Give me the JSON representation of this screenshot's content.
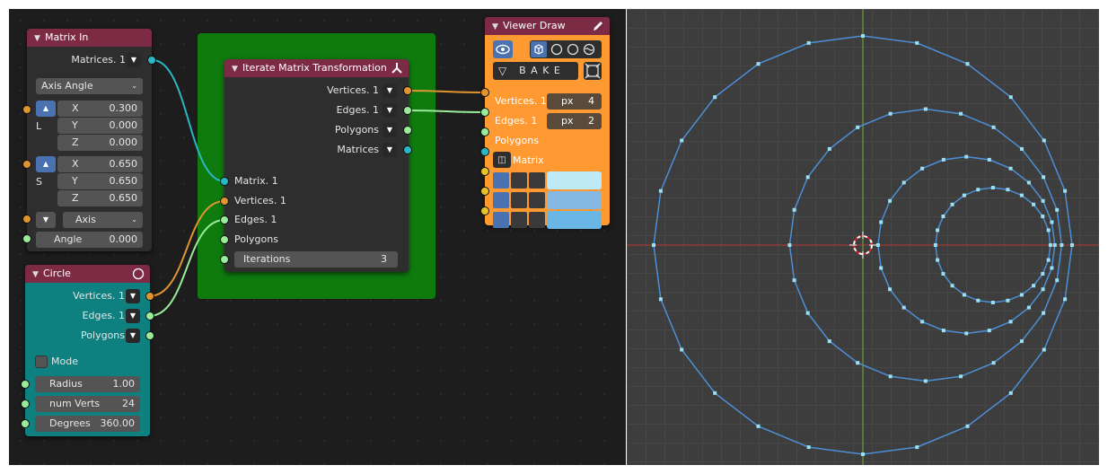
{
  "colors": {
    "matrix_socket": "#2bb6c4",
    "vertices_socket": "#e09530",
    "edges_socket": "#9aeb9a",
    "float_socket": "#a0a0a0",
    "header_red": "#7d2a44",
    "frame_green": "#0f7b0f",
    "circle_body": "#0f8080",
    "viewer_body": "#ff9a33",
    "wire_blue": "#4c8fd6"
  },
  "matrix_in": {
    "title": "Matrix In",
    "output_label": "Matrices. 1",
    "mode": "Axis Angle",
    "location": {
      "label": "L",
      "x_label": "X",
      "x": "0.300",
      "y_label": "Y",
      "y": "0.000",
      "z_label": "Z",
      "z": "0.000"
    },
    "scale": {
      "label": "S",
      "x_label": "X",
      "x": "0.650",
      "y_label": "Y",
      "y": "0.650",
      "z_label": "Z",
      "z": "0.650"
    },
    "axis_label": "Axis",
    "angle_label": "Angle",
    "angle": "0.000"
  },
  "circle": {
    "title": "Circle",
    "outputs": [
      "Vertices. 1",
      "Edges. 1",
      "Polygons"
    ],
    "mode_label": "Mode",
    "radius_label": "Radius",
    "radius": "1.00",
    "verts_label": "num Verts",
    "verts": "24",
    "degrees_label": "Degrees",
    "degrees": "360.00"
  },
  "iterate": {
    "title": "Iterate Matrix Transformation",
    "outputs": [
      "Vertices. 1",
      "Edges. 1",
      "Polygons",
      "Matrices"
    ],
    "inputs": [
      "Matrix. 1",
      "Vertices. 1",
      "Edges. 1",
      "Polygons"
    ],
    "iterations_label": "Iterations",
    "iterations": "3"
  },
  "viewer": {
    "title": "Viewer Draw",
    "bake_label": "B A K E",
    "inputs": [
      "Vertices. 1",
      "Edges. 1",
      "Polygons",
      "Matrix"
    ],
    "vert_size_unit": "px",
    "vert_size": "4",
    "edge_width_unit": "px",
    "edge_width": "2",
    "swatch_colors": [
      "#bdeaf5",
      "#85b8e0",
      "#6ab7e6"
    ]
  },
  "viewport": {
    "circle_vertex_count": 24
  }
}
